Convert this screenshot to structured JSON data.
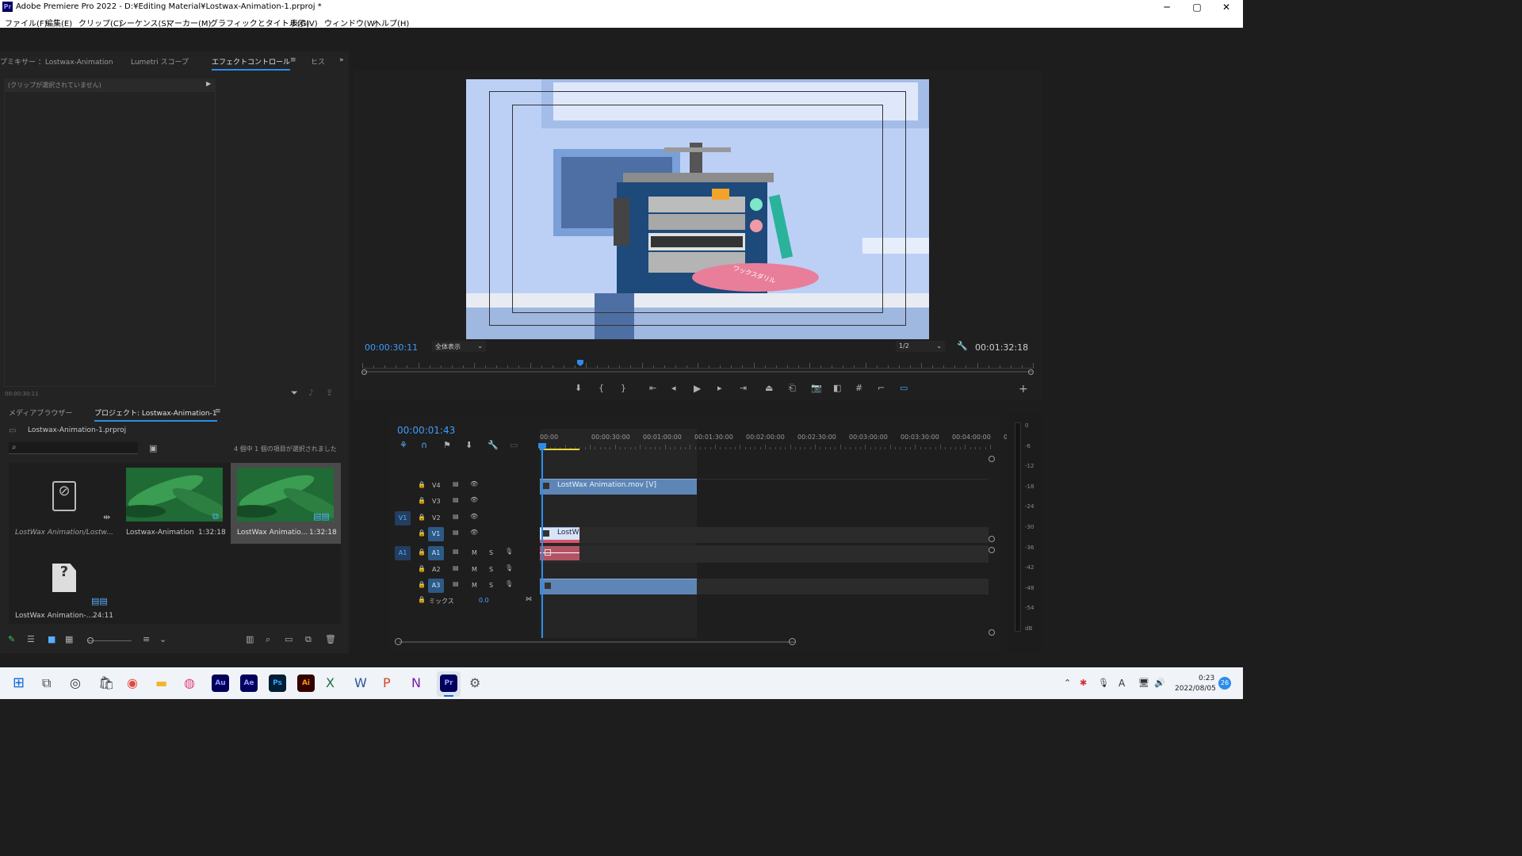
{
  "titlebar": {
    "app_logo": "Pr",
    "title": "Adobe Premiere Pro 2022 - D:¥Editing Material¥Lostwax-Animation-1.prproj *",
    "minimize": "─",
    "maximize": "▢",
    "close": "✕"
  },
  "menu": [
    "ファイル(F)",
    "編集(E)",
    "クリップ(C)",
    "シーケンス(S)",
    "マーカー(M)",
    "グラフィックとタイトル(G)",
    "表示(V)",
    "ウィンドウ(W)",
    "ヘルプ(H)"
  ],
  "effects_panel": {
    "tabs": [
      "プミキサー ：Lostwax-Animation",
      "Lumetri スコープ",
      "エフェクトコントロール",
      "ヒス"
    ],
    "active_tab": "エフェクトコントロール",
    "no_clip_text": "(クリップが選択されていません)",
    "timecode": "00:00:30:11"
  },
  "program_monitor": {
    "current_time": "00:00:30:11",
    "zoom_select": "全体表示",
    "resolution_select": "1/2",
    "duration": "00:01:32:18",
    "playhead_position": 0.325,
    "frame_text": "ワックスダリル"
  },
  "project_panel": {
    "tabs": [
      "メディアブラウザー",
      "プロジェクト: Lostwax-Animation-1"
    ],
    "file_name": "Lostwax-Animation-1.prproj",
    "selection_status": "4 個中 1 個の項目が選択されました",
    "items": [
      {
        "name": "LostWax Animation/Lostw...",
        "duration": "",
        "kind": "offline"
      },
      {
        "name": "Lostwax-Animation",
        "duration": "1:32:18",
        "kind": "sequence"
      },
      {
        "name": "LostWax Animatio...",
        "duration": "1:32:18",
        "kind": "clip"
      },
      {
        "name": "LostWax Animation-...",
        "duration": "24:11",
        "kind": "missing"
      }
    ]
  },
  "timeline": {
    "timecode": "00:00:01:43",
    "ruler": [
      "00:00",
      "00:00:30:00",
      "00:01:00:00",
      "00:01:30:00",
      "00:02:00:00",
      "00:02:30:00",
      "00:03:00:00",
      "00:03:30:00",
      "00:04:00:00",
      "0"
    ],
    "video_tracks": [
      "V4",
      "V3",
      "V2",
      "V1"
    ],
    "audio_tracks": [
      "A1",
      "A2",
      "A3"
    ],
    "source_v": "V1",
    "source_a": "A1",
    "mix_label": "ミックス",
    "mix_value": "0.0",
    "clip_v4": "LostWax Animation.mov [V]",
    "clip_v1": "LostW"
  },
  "audio_meter": {
    "scale": [
      "0",
      "-6",
      "-12",
      "-18",
      "-24",
      "-30",
      "-36",
      "-42",
      "-48",
      "-54",
      "dB"
    ]
  },
  "taskbar": {
    "apps": [
      "Au",
      "Ae",
      "Ps",
      "Ai",
      "Pr"
    ],
    "time": "0:23",
    "date": "2022/08/05",
    "notifications": "26",
    "ime": "A"
  }
}
